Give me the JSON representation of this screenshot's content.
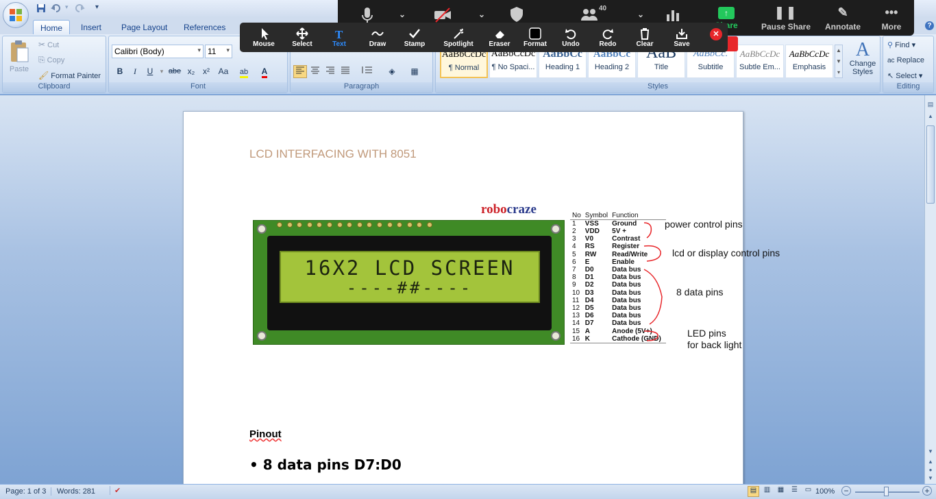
{
  "quick_access": {
    "save_icon": "save-icon",
    "undo_icon": "undo-icon",
    "redo_icon": "redo-icon"
  },
  "tabs": [
    {
      "label": "Home",
      "active": true
    },
    {
      "label": "Insert"
    },
    {
      "label": "Page Layout"
    },
    {
      "label": "References"
    }
  ],
  "clipboard": {
    "paste": "Paste",
    "cut": "Cut",
    "copy": "Copy",
    "format_painter": "Format Painter",
    "group": "Clipboard"
  },
  "font": {
    "family": "Calibri (Body)",
    "size": "11",
    "group": "Font",
    "buttons": [
      "B",
      "I",
      "U",
      "abe",
      "x₂",
      "x²",
      "Aa"
    ]
  },
  "paragraph": {
    "group": "Paragraph"
  },
  "styles": {
    "group": "Styles",
    "items": [
      {
        "preview": "AaBbCcDc",
        "name": "¶ Normal"
      },
      {
        "preview": "AaBbCcDc",
        "name": "¶ No Spaci..."
      },
      {
        "preview": "AaBbCc",
        "name": "Heading 1"
      },
      {
        "preview": "AaBbCc",
        "name": "Heading 2"
      },
      {
        "preview": "AaB",
        "name": "Title"
      },
      {
        "preview": "AaBbCc.",
        "name": "Subtitle"
      },
      {
        "preview": "AaBbCcDc",
        "name": "Subtle Em..."
      },
      {
        "preview": "AaBbCcDc",
        "name": "Emphasis"
      }
    ],
    "change_styles": "Change Styles"
  },
  "editing": {
    "find": "Find",
    "replace": "Replace",
    "select": "Select",
    "group": "Editing"
  },
  "zoom_toolbar": {
    "participants_count": "40",
    "share": "Share",
    "pause_share": "Pause Share",
    "annotate": "Annotate",
    "more": "More"
  },
  "annotate_tools": [
    "Mouse",
    "Select",
    "Text",
    "Draw",
    "Stamp",
    "Spotlight",
    "Eraser",
    "Format",
    "Undo",
    "Redo",
    "Clear",
    "Save"
  ],
  "document": {
    "heading": "LCD INTERFACING  WITH 8051",
    "brand": "robocraze",
    "lcd_line1": "16X2 LCD SCREEN",
    "lcd_line2": "----##----",
    "pin_labels": [
      "VSS",
      "VDD",
      "V0",
      "RS",
      "RW",
      "E",
      "D0",
      "D1",
      "D2",
      "D3",
      "D4",
      "D5",
      "D6",
      "D7",
      "A",
      "K"
    ],
    "pin_table_headers": [
      "No",
      "Symbol",
      "Function"
    ],
    "pin_table": [
      [
        "1",
        "VSS",
        "Ground"
      ],
      [
        "2",
        "VDD",
        "5V +"
      ],
      [
        "3",
        "V0",
        "Contrast"
      ],
      [
        "4",
        "RS",
        "Register"
      ],
      [
        "5",
        "RW",
        "Read/Write"
      ],
      [
        "6",
        "E",
        "Enable"
      ],
      [
        "7",
        "D0",
        "Data bus"
      ],
      [
        "8",
        "D1",
        "Data bus"
      ],
      [
        "9",
        "D2",
        "Data bus"
      ],
      [
        "10",
        "D3",
        "Data bus"
      ],
      [
        "11",
        "D4",
        "Data bus"
      ],
      [
        "12",
        "D5",
        "Data bus"
      ],
      [
        "13",
        "D6",
        "Data bus"
      ],
      [
        "14",
        "D7",
        "Data bus"
      ],
      [
        "15",
        "A",
        "Anode (5V+)"
      ],
      [
        "16",
        "K",
        "Cathode (GND)"
      ]
    ],
    "annotations": {
      "power": "power control pins",
      "lcd": "lcd or display control pins",
      "data": "8 data pins",
      "led1": "LED pins",
      "led2": "for back light"
    },
    "pinout_heading": "Pinout",
    "bullet": "• 8 data pins D7:D0"
  },
  "status": {
    "page": "Page: 1 of 3",
    "words": "Words: 281",
    "zoom": "100%"
  },
  "colors": {
    "heading": "#c0997a",
    "annotation_red": "#e8262a",
    "lcd_green": "#a3c43b",
    "board_green": "#3f8a26"
  }
}
